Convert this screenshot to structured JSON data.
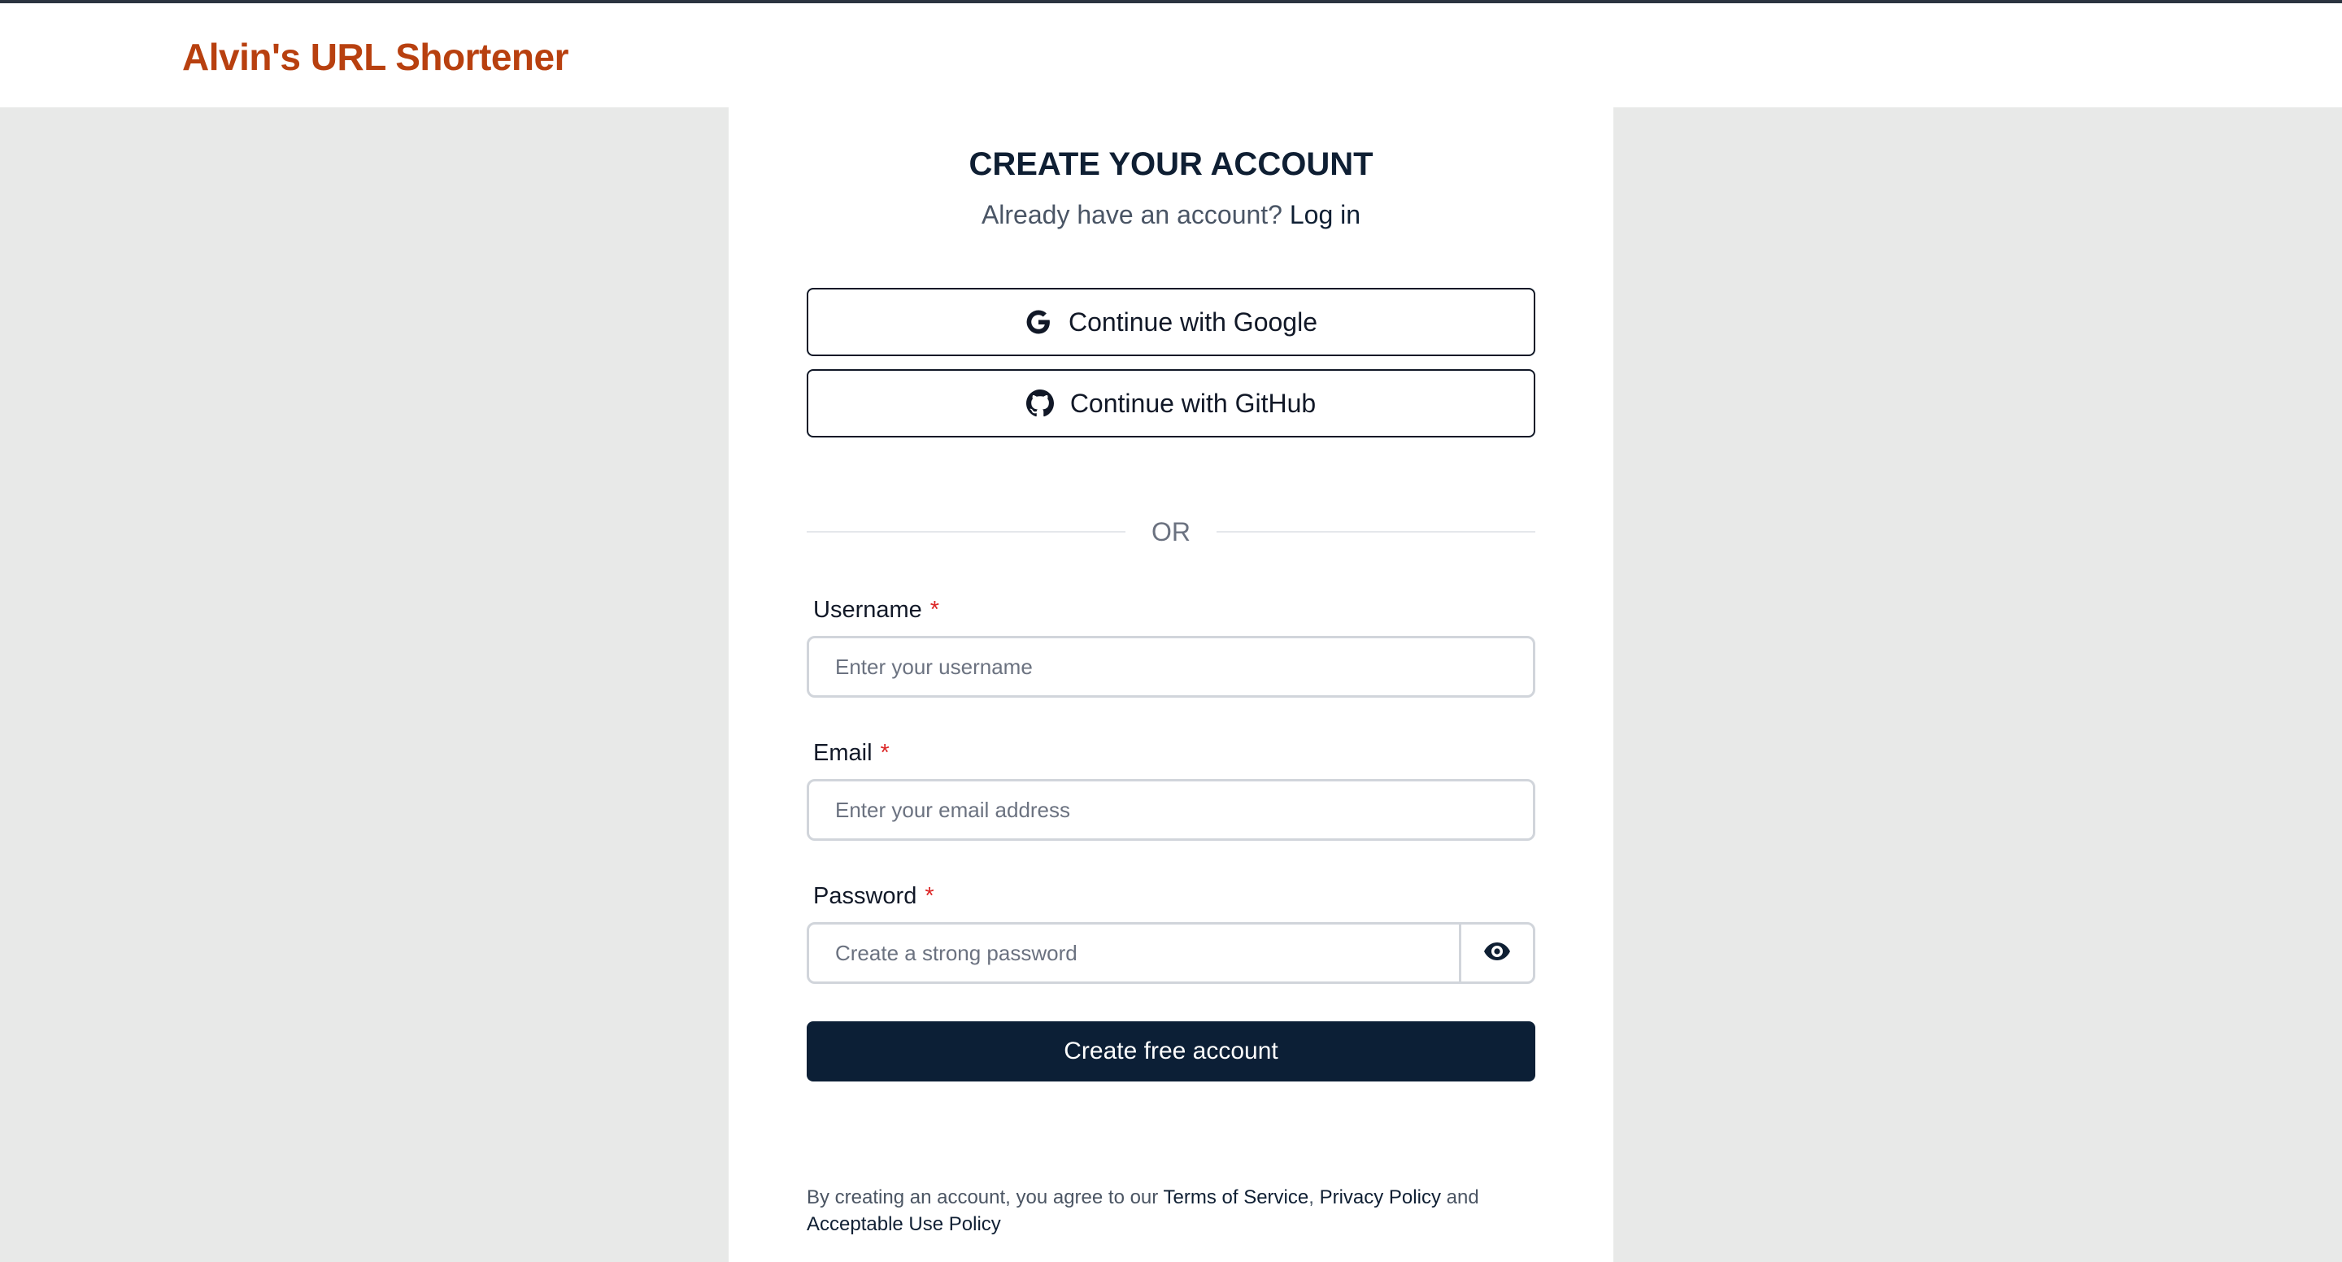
{
  "header": {
    "brand": "Alvin's URL Shortener"
  },
  "card": {
    "title": "CREATE YOUR ACCOUNT",
    "subtitle_text": "Already have an account?",
    "login_link": "Log in"
  },
  "oauth": {
    "google_label": "Continue with Google",
    "google_icon": "google-g-icon",
    "github_label": "Continue with GitHub",
    "github_icon": "github-icon"
  },
  "divider": {
    "text": "OR"
  },
  "form": {
    "username": {
      "label": "Username",
      "required_mark": "*",
      "placeholder": "Enter your username",
      "value": ""
    },
    "email": {
      "label": "Email",
      "required_mark": "*",
      "placeholder": "Enter your email address",
      "value": ""
    },
    "password": {
      "label": "Password",
      "required_mark": "*",
      "placeholder": "Create a strong password",
      "value": "",
      "toggle_icon": "eye-icon"
    },
    "submit_label": "Create free account"
  },
  "legal": {
    "prefix": "By creating an account, you agree to our",
    "terms": "Terms of Service",
    "comma": ",",
    "privacy": "Privacy Policy",
    "and": "and",
    "aup": "Acceptable Use Policy"
  },
  "colors": {
    "brand": "#b8400f",
    "primary_button": "#0c1f36",
    "required": "#dc2626",
    "page_background": "#e8e9e8"
  }
}
